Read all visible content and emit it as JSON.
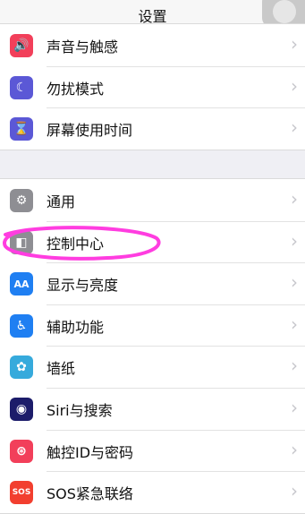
{
  "header": {
    "title": "设置"
  },
  "group1": [
    {
      "label": "声音与触感",
      "icon": "speaker-icon",
      "color": "#f23f5a",
      "glyph": "🔊"
    },
    {
      "label": "勿扰模式",
      "icon": "moon-icon",
      "color": "#5b58d6",
      "glyph": "☾"
    },
    {
      "label": "屏幕使用时间",
      "icon": "hourglass-icon",
      "color": "#5b58d6",
      "glyph": "⌛"
    }
  ],
  "group2": [
    {
      "label": "通用",
      "icon": "gear-icon",
      "color": "#8e8e93",
      "glyph": "⚙"
    },
    {
      "label": "控制中心",
      "icon": "toggle-icon",
      "color": "#8e8e93",
      "glyph": "◧"
    },
    {
      "label": "显示与亮度",
      "icon": "text-size-icon",
      "color": "#1f7ff2",
      "glyph": "AA"
    },
    {
      "label": "辅助功能",
      "icon": "accessibility-icon",
      "color": "#1f7ff2",
      "glyph": "♿"
    },
    {
      "label": "墙纸",
      "icon": "wallpaper-flower-icon",
      "color": "#36aadc",
      "glyph": "✿"
    },
    {
      "label": "Siri与搜索",
      "icon": "siri-icon",
      "color": "#1c1c6a",
      "glyph": "◉"
    },
    {
      "label": "触控ID与密码",
      "icon": "fingerprint-icon",
      "color": "#f23f5a",
      "glyph": "⊛"
    },
    {
      "label": "SOS紧急联络",
      "icon": "sos-icon",
      "color": "#f23f2f",
      "glyph": "SOS"
    }
  ],
  "chevron": "›",
  "highlight_color": "#ff3de0"
}
